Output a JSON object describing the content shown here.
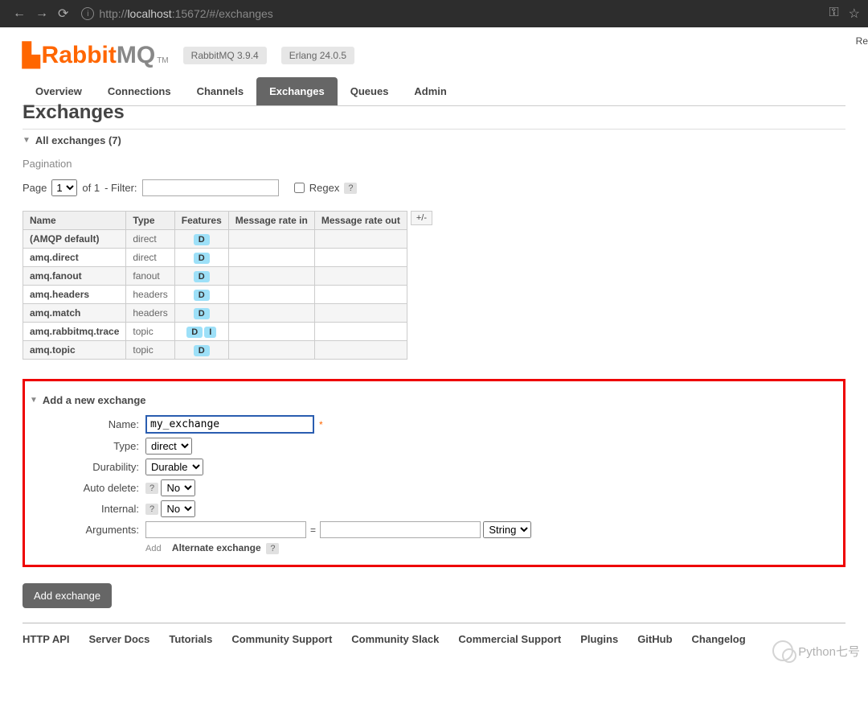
{
  "browser": {
    "url_prefix": "http://",
    "url_host": "localhost",
    "url_rest": ":15672/#/exchanges"
  },
  "header": {
    "logo_rabbit": "Rabbit",
    "logo_mq": "MQ",
    "tm": "TM",
    "version_badge": "RabbitMQ 3.9.4",
    "erlang_badge": "Erlang 24.0.5",
    "topright": "Re"
  },
  "tabs": [
    {
      "label": "Overview"
    },
    {
      "label": "Connections"
    },
    {
      "label": "Channels"
    },
    {
      "label": "Exchanges",
      "active": true
    },
    {
      "label": "Queues"
    },
    {
      "label": "Admin"
    }
  ],
  "page_title": "Exchanges",
  "section_all": "All exchanges (7)",
  "pagination_label": "Pagination",
  "pager": {
    "page_lbl": "Page",
    "page_val": "1",
    "of": "of 1",
    "filter_lbl": "- Filter:",
    "regex_lbl": "Regex",
    "help": "?"
  },
  "table": {
    "headers": [
      "Name",
      "Type",
      "Features",
      "Message rate in",
      "Message rate out"
    ],
    "adjust": "+/-",
    "rows": [
      {
        "name": "(AMQP default)",
        "type": "direct",
        "features": [
          "D"
        ]
      },
      {
        "name": "amq.direct",
        "type": "direct",
        "features": [
          "D"
        ]
      },
      {
        "name": "amq.fanout",
        "type": "fanout",
        "features": [
          "D"
        ]
      },
      {
        "name": "amq.headers",
        "type": "headers",
        "features": [
          "D"
        ]
      },
      {
        "name": "amq.match",
        "type": "headers",
        "features": [
          "D"
        ]
      },
      {
        "name": "amq.rabbitmq.trace",
        "type": "topic",
        "features": [
          "D",
          "I"
        ]
      },
      {
        "name": "amq.topic",
        "type": "topic",
        "features": [
          "D"
        ]
      }
    ]
  },
  "section_add": "Add a new exchange",
  "form": {
    "name_lbl": "Name:",
    "name_val": "my_exchange",
    "type_lbl": "Type:",
    "type_val": "direct",
    "durability_lbl": "Durability:",
    "durability_val": "Durable",
    "autodelete_lbl": "Auto delete:",
    "autodelete_val": "No",
    "internal_lbl": "Internal:",
    "internal_val": "No",
    "args_lbl": "Arguments:",
    "args_type": "String",
    "add_txt": "Add",
    "alt_ex": "Alternate exchange",
    "help": "?",
    "submit": "Add exchange",
    "required": "*"
  },
  "footer": [
    "HTTP API",
    "Server Docs",
    "Tutorials",
    "Community Support",
    "Community Slack",
    "Commercial Support",
    "Plugins",
    "GitHub",
    "Changelog"
  ],
  "watermark": "Python七号"
}
